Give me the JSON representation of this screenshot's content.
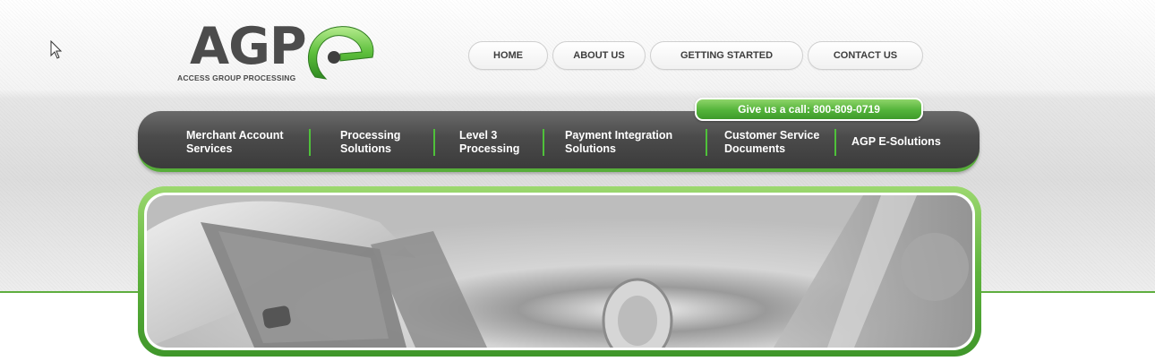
{
  "brand": {
    "logo_text": "AGP",
    "tagline": "ACCESS GROUP PROCESSING",
    "accent_color": "#5fae3f",
    "nav_bg_color": "#4b4b4b"
  },
  "top_nav": {
    "items": [
      {
        "label": "HOME"
      },
      {
        "label": "ABOUT US"
      },
      {
        "label": "GETTING STARTED"
      },
      {
        "label": "CONTACT US"
      }
    ]
  },
  "call_tab": {
    "label": "Give us a call: 800-809-0719"
  },
  "main_nav": {
    "items": [
      {
        "line1": "Merchant Account",
        "line2": "Services"
      },
      {
        "line1": "Processing",
        "line2": "Solutions"
      },
      {
        "line1": "Level 3",
        "line2": "Processing"
      },
      {
        "line1": "Payment Integration",
        "line2": "Solutions"
      },
      {
        "line1": "Customer Service",
        "line2": "Documents"
      },
      {
        "line1": "AGP E-Solutions",
        "line2": ""
      }
    ]
  },
  "banner": {
    "icon": "credit-card-money-photo"
  }
}
